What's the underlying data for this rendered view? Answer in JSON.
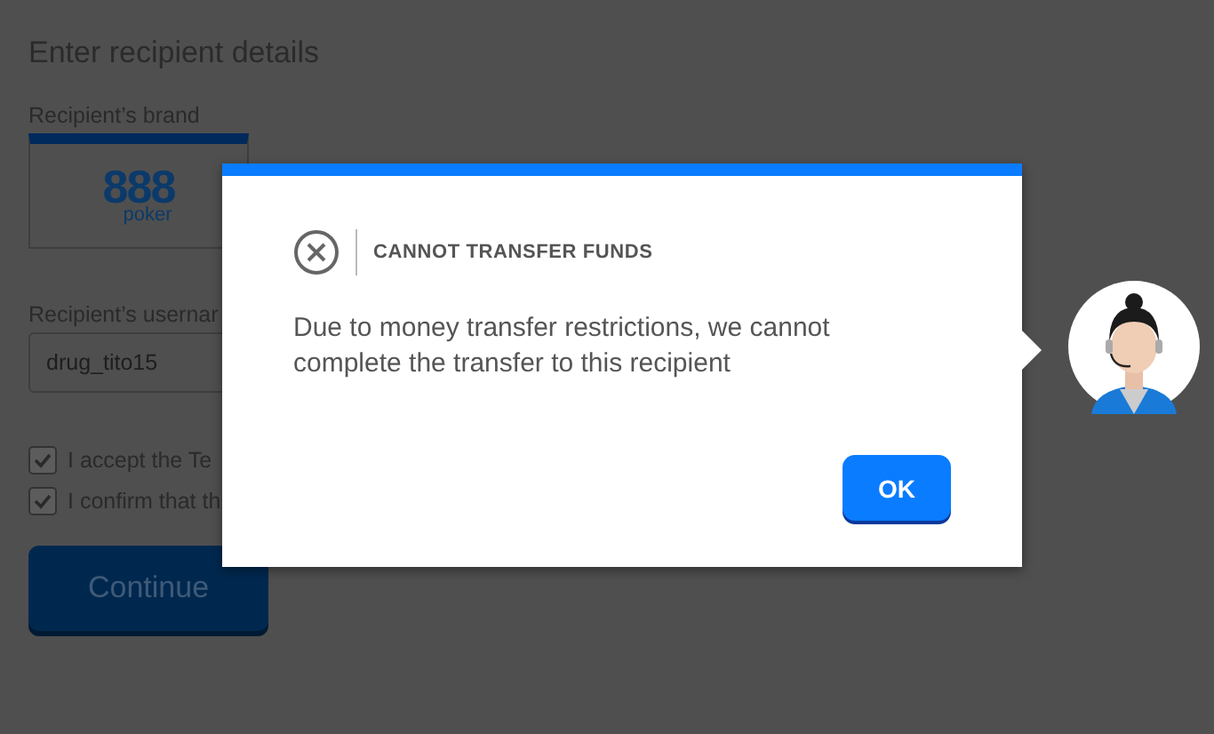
{
  "page": {
    "heading": "Enter recipient details",
    "brand_label": "Recipient’s brand",
    "brand_logo": {
      "number": "888",
      "word": "poker"
    },
    "username_label": "Recipient’s usernar",
    "username_value": "drug_tito15",
    "checkboxes": [
      {
        "label": "I accept the Te",
        "checked": true
      },
      {
        "label": "I confirm that th",
        "checked": true
      }
    ],
    "continue_button": "Continue"
  },
  "dialog": {
    "title": "CANNOT TRANSFER FUNDS",
    "message": "Due to money transfer restrictions, we cannot complete the transfer to this recipient",
    "ok_button": "OK"
  }
}
